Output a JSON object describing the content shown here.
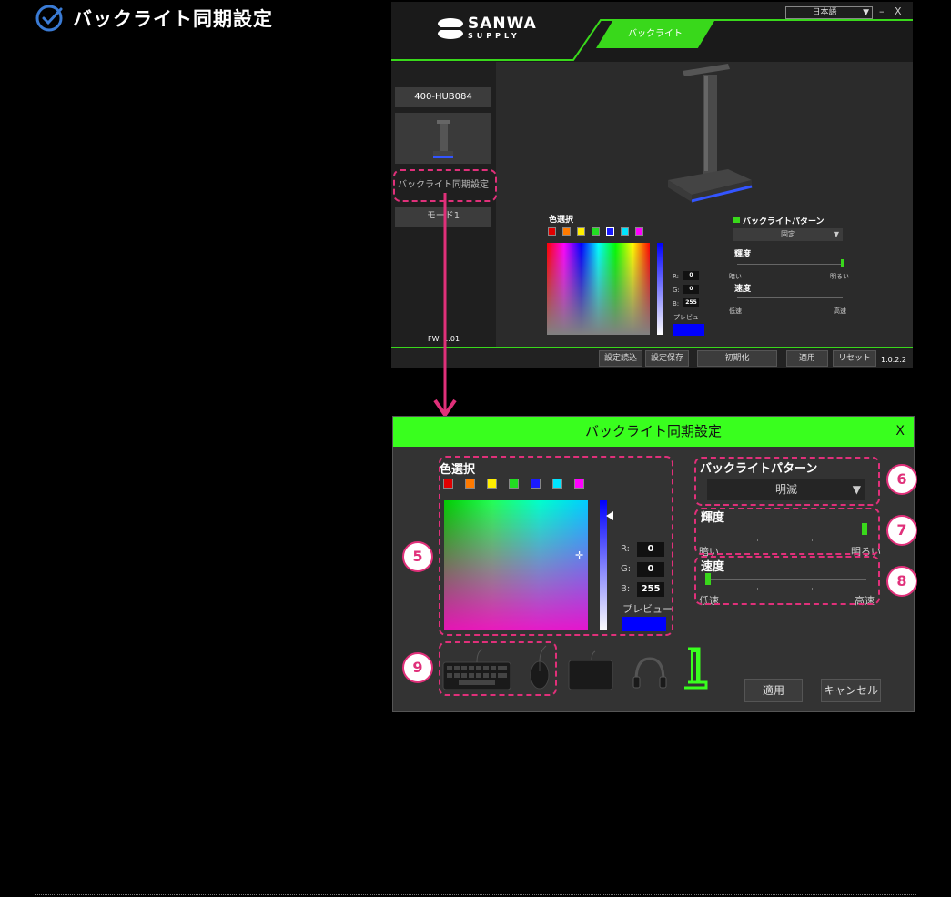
{
  "heading": {
    "title": "バックライト同期設定"
  },
  "app": {
    "brand_top": "SANWA",
    "brand_bottom": "SUPPLY",
    "language": "日本語",
    "window_controls": [
      "–",
      "X"
    ],
    "active_tab": "バックライト",
    "device_name": "400-HUB084",
    "sync_menu": "バックライト同期設定",
    "mode": "モード1",
    "firmware": "FW: 1.01",
    "color_select_label": "色選択",
    "rgb": {
      "r_label": "R:",
      "r": "0",
      "g_label": "G:",
      "g": "0",
      "b_label": "B:",
      "b": "255"
    },
    "preview_label": "プレビュー",
    "pattern_label": "バックライトパターン",
    "pattern_value": "固定",
    "brightness_label": "輝度",
    "brightness_low": "暗い",
    "brightness_high": "明るい",
    "brightness_level": 1.0,
    "speed_label": "速度",
    "speed_low": "低速",
    "speed_high": "高速",
    "buttons": [
      "設定読込",
      "設定保存",
      "初期化",
      "適用",
      "リセット"
    ],
    "version": "1.0.2.2"
  },
  "dialog": {
    "title": "バックライト同期設定",
    "close": "X",
    "color_select_label": "色選択",
    "swatches": [
      "#e00000",
      "#ff7a00",
      "#ffee00",
      "#22dd22",
      "#1a1aff",
      "#00e5ff",
      "#ff00ff"
    ],
    "rgb": {
      "r_label": "R:",
      "r": "0",
      "g_label": "G:",
      "g": "0",
      "b_label": "B:",
      "b": "255"
    },
    "preview_label": "プレビュー",
    "preview_color": "#0000ff",
    "pattern_label": "バックライトパターン",
    "pattern_value": "明滅",
    "brightness_label": "輝度",
    "brightness_low": "暗い",
    "brightness_high": "明るい",
    "brightness_level": 1.0,
    "speed_label": "速度",
    "speed_low": "低速",
    "speed_high": "高速",
    "speed_level": 0.0,
    "apply": "適用",
    "cancel": "キャンセル",
    "devices": [
      "keyboard-icon",
      "mouse-icon",
      "mousepad-icon",
      "headphones-icon",
      "headset-stand-icon"
    ]
  },
  "callouts": [
    "5",
    "6",
    "7",
    "8",
    "9"
  ],
  "colors": {
    "accent_green": "#39ff1e",
    "callout_pink": "#e0307a"
  }
}
